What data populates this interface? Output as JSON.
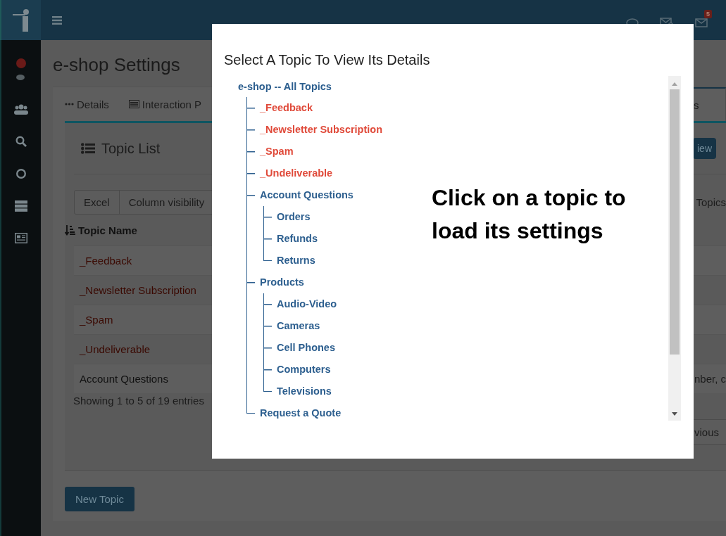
{
  "topbar": {
    "badge": "5"
  },
  "page": {
    "title": "e-shop Settings",
    "tabs": [
      {
        "label": "Details",
        "selected": false
      },
      {
        "label": "Interaction P",
        "selected": false
      },
      {
        "label": "s",
        "selected": true
      }
    ],
    "panel": {
      "title": "Topic List",
      "button_fragment": "iew",
      "export_buttons": [
        "Excel",
        "Column visibility"
      ],
      "filter_fragment": "Topics",
      "columns": [
        {
          "label": "Topic Name"
        }
      ],
      "rows": [
        {
          "name": "_Feedback",
          "kind": "system"
        },
        {
          "name": "_Newsletter Subscription",
          "kind": "system"
        },
        {
          "name": "_Spam",
          "kind": "system"
        },
        {
          "name": "_Undeliverable",
          "kind": "system"
        },
        {
          "name": "Account Questions",
          "kind": "topic",
          "column_2": "nber, c"
        }
      ],
      "info": "Showing 1 to 5 of 19 entries",
      "pagination_fragment": "vious"
    },
    "new_button": "New Topic"
  },
  "modal": {
    "title": "Select A Topic To View Its Details",
    "tree": {
      "label": "e-shop -- All Topics",
      "kind": "topic",
      "children": [
        {
          "label": "_Feedback",
          "kind": "system"
        },
        {
          "label": "_Newsletter Subscription",
          "kind": "system"
        },
        {
          "label": "_Spam",
          "kind": "system"
        },
        {
          "label": "_Undeliverable",
          "kind": "system"
        },
        {
          "label": "Account Questions",
          "kind": "topic",
          "children": [
            {
              "label": "Orders",
              "kind": "topic"
            },
            {
              "label": "Refunds",
              "kind": "topic"
            },
            {
              "label": "Returns",
              "kind": "topic"
            }
          ]
        },
        {
          "label": "Products",
          "kind": "topic",
          "children": [
            {
              "label": "Audio-Video",
              "kind": "topic"
            },
            {
              "label": "Cameras",
              "kind": "topic"
            },
            {
              "label": "Cell Phones",
              "kind": "topic"
            },
            {
              "label": "Computers",
              "kind": "topic"
            },
            {
              "label": "Televisions",
              "kind": "topic"
            }
          ]
        },
        {
          "label": "Request a Quote",
          "kind": "topic"
        }
      ]
    },
    "message": "Click on a topic to load its settings"
  }
}
